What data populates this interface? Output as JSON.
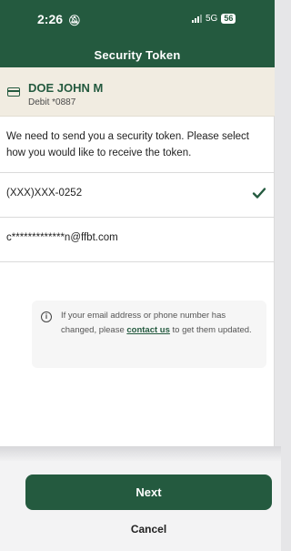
{
  "status_bar": {
    "time": "2:26",
    "silent_icon": "bell-slash-icon",
    "network": "5G",
    "battery": "56"
  },
  "header": {
    "title": "Security Token"
  },
  "account": {
    "name": "DOE JOHN M",
    "sub": "Debit *0887",
    "icon": "card-icon"
  },
  "instructions": "We need to send you a security token. Please select how you would like to receive the token.",
  "options": [
    {
      "label": "(XXX)XXX-0252",
      "selected": true
    },
    {
      "label": "c*************n@ffbt.com",
      "selected": false
    }
  ],
  "info": {
    "text_before": "If your email address or phone number has changed,  please ",
    "link": "contact us",
    "text_after": " to get them updated."
  },
  "buttons": {
    "next": "Next",
    "cancel": "Cancel"
  },
  "colors": {
    "brand": "#245a3f",
    "account_bg": "#f1ece1"
  }
}
